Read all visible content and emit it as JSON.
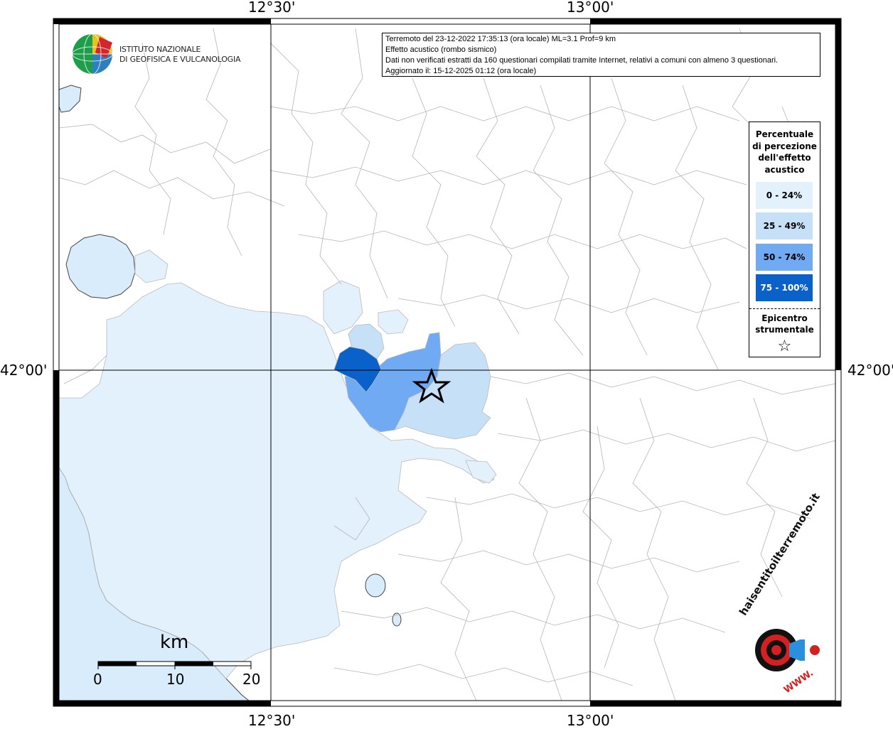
{
  "header": {
    "line1": "Terremoto del 23-12-2022 17:35:13 (ora locale) ML=3.1 Prof=9 km",
    "line2": "Effetto acustico (rombo sismico)",
    "line3": "Dati non verificati estratti da 160 questionari compilati tramite Internet, relativi a comuni con almeno 3 questionari.",
    "line4": "Aggiornato il: 15-12-2025 01:12 (ora locale)"
  },
  "institute": {
    "name_line1": "ISTITUTO NAZIONALE",
    "name_line2": "DI GEOFISICA E VULCANOLOGIA"
  },
  "grid_labels": {
    "lon_left_top": "12°30'",
    "lon_right_top": "13°00'",
    "lon_left_bottom": "12°30'",
    "lon_right_bottom": "13°00'",
    "lat_left": "42°00'",
    "lat_right": "42°00'"
  },
  "legend": {
    "title": "Percentuale di percezione dell'effetto acustico",
    "classes": [
      {
        "label": "0 - 24%",
        "color": "#e2f1fc"
      },
      {
        "label": "25 - 49%",
        "color": "#c6e0f8"
      },
      {
        "label": "50 - 74%",
        "color": "#70aaf2"
      },
      {
        "label": "75 - 100%",
        "color": "#0a61c9"
      }
    ],
    "epicenter_label": "Epicentro strumentale",
    "epicenter_symbol": "☆"
  },
  "scale_bar": {
    "unit": "km",
    "ticks": [
      "0",
      "10",
      "20"
    ]
  },
  "branding": {
    "haisentito_text": "haisentitoilterremoto.it",
    "www_text": "WWW.",
    "colors": {
      "red": "#d42020",
      "blue": "#2b8fdc",
      "sea": "#d9ecfb"
    }
  }
}
